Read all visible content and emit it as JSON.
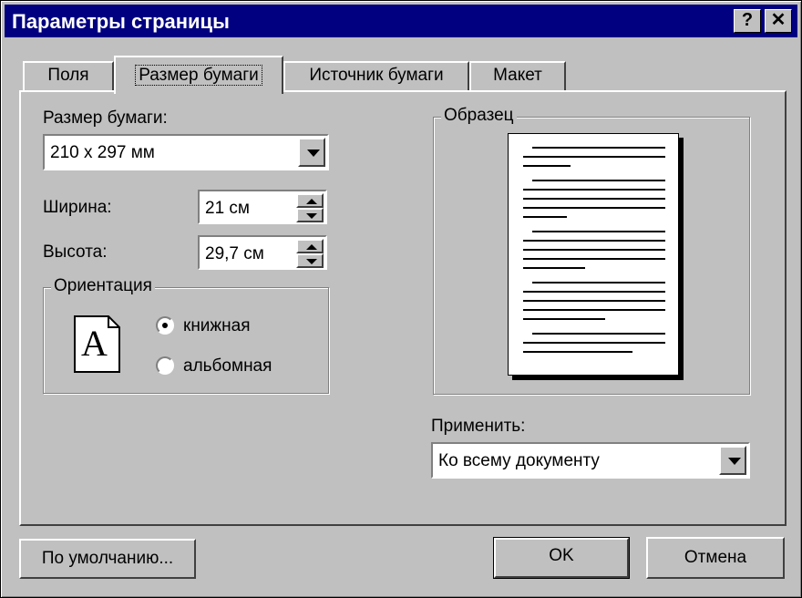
{
  "window": {
    "title": "Параметры страницы",
    "help_button": "?",
    "close_button": "✕"
  },
  "tabs": [
    {
      "label": "Поля",
      "selected": false
    },
    {
      "label": "Размер бумаги",
      "selected": true
    },
    {
      "label": "Источник бумаги",
      "selected": false
    },
    {
      "label": "Макет",
      "selected": false
    }
  ],
  "paper_size": {
    "label": "Размер бумаги:",
    "value": "210 x 297 мм"
  },
  "width": {
    "label": "Ширина:",
    "value": "21 см"
  },
  "height": {
    "label": "Высота:",
    "value": "29,7 см"
  },
  "orientation": {
    "title": "Ориентация",
    "icon_letter": "A",
    "options": [
      {
        "label": "книжная",
        "checked": true
      },
      {
        "label": "альбомная",
        "checked": false
      }
    ]
  },
  "preview": {
    "title": "Образец"
  },
  "apply": {
    "label": "Применить:",
    "value": "Ко всему документу"
  },
  "buttons": {
    "default": "По умолчанию...",
    "ok": "OK",
    "cancel": "Отмена"
  }
}
